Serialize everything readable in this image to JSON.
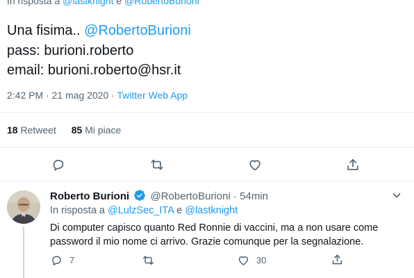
{
  "main_tweet": {
    "reply_prefix": "In risposta a",
    "reply_handle_1": "@lastknight",
    "reply_and": "e",
    "reply_handle_2": "@RobertoBurioni",
    "text_line1_plain": "Una fisima..",
    "text_line1_mention": "@RobertoBurioni",
    "text_line2": "pass: burioni.roberto",
    "text_line3": "email: burioni.roberto@hsr.it",
    "time": "2:42 PM",
    "separator": "·",
    "date": "21 mag 2020",
    "source": "Twitter Web App",
    "retweets_count": "18",
    "retweets_label": "Retweet",
    "likes_count": "85",
    "likes_label": "Mi piace"
  },
  "reply_tweet": {
    "name": "Roberto Burioni",
    "handle": "@RobertoBurioni",
    "separator": "·",
    "age": "54min",
    "reply_prefix": "In risposta a",
    "reply_handle_1": "@LulzSec_ITA",
    "reply_and": "e",
    "reply_handle_2": "@lastknight",
    "text_line1": "Di computer capisco quanto Red Ronnie di vaccini, ma a non usare come",
    "text_line2": "password il mio nome ci arrivo. Grazie comunque per la segnalazione.",
    "reply_count": "7",
    "retweet_count": "",
    "like_count": "30"
  },
  "colors": {
    "accent": "#1d9bf0",
    "text": "#0f1419",
    "secondary": "#536471",
    "divider": "#e6ecf0"
  },
  "icons": [
    "reply-icon",
    "retweet-icon",
    "like-icon",
    "share-icon",
    "verified-badge-icon",
    "chevron-down-icon"
  ]
}
